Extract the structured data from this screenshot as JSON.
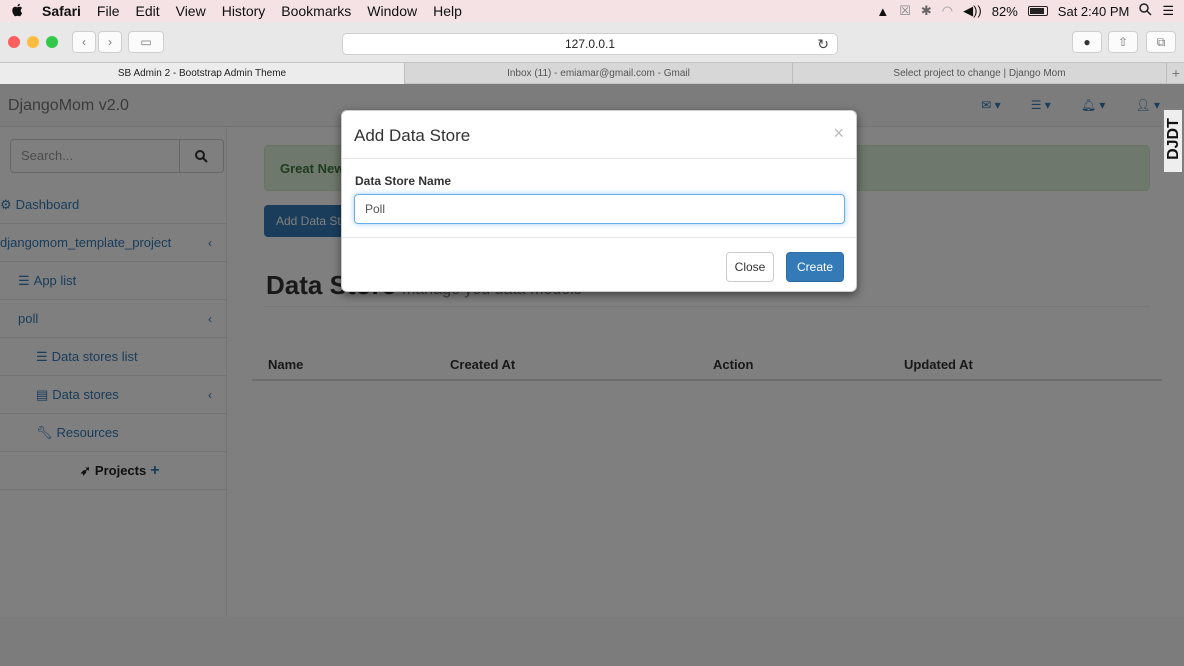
{
  "menubar": {
    "app": "Safari",
    "items": [
      "File",
      "Edit",
      "View",
      "History",
      "Bookmarks",
      "Window",
      "Help"
    ],
    "battery": "82%",
    "clock": "Sat 2:40 PM"
  },
  "toolbar": {
    "address": "127.0.0.1"
  },
  "tabs": [
    {
      "label": "SB Admin 2 - Bootstrap Admin Theme"
    },
    {
      "label": "Inbox (11) - emiamar@gmail.com - Gmail"
    },
    {
      "label": "Select project to change | Django Mom"
    }
  ],
  "navbar": {
    "brand": "DjangoMom v2.0"
  },
  "sidebar": {
    "search_placeholder": "Search...",
    "items": [
      {
        "label": "Dashboard"
      },
      {
        "label": "djangomom_template_project"
      },
      {
        "label": "App list"
      },
      {
        "label": "poll"
      },
      {
        "label": "Data stores list"
      },
      {
        "label": "Data stores"
      },
      {
        "label": "Resources"
      },
      {
        "label": "Projects"
      }
    ]
  },
  "content": {
    "alert": "Great New",
    "add_button": "Add Data Store",
    "heading": "Data Store",
    "heading_sub": "manage you data models",
    "columns": [
      "Name",
      "Created At",
      "Action",
      "Updated At"
    ]
  },
  "modal": {
    "title": "Add Data Store",
    "close_x": "×",
    "field_label": "Data Store Name",
    "field_value": "Poll",
    "close_button": "Close",
    "create_button": "Create"
  },
  "djdt": {
    "label": "DJDT"
  },
  "colors": {
    "primary": "#337ab7",
    "alert_bg": "#dff0d8",
    "alert_text": "#3c763d"
  }
}
